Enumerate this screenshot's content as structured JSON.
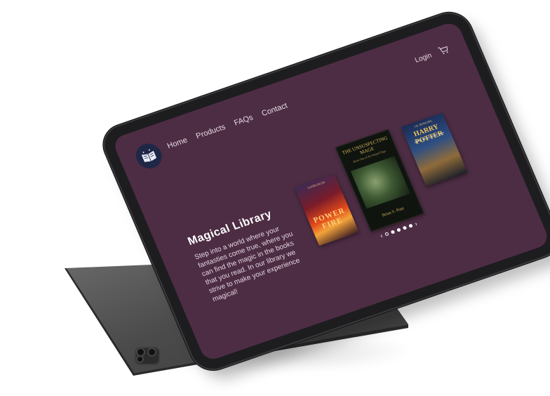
{
  "site": {
    "brand_logo": "open-book-icon",
    "nav": [
      "Home",
      "Products",
      "FAQs",
      "Contact"
    ],
    "login_label": "Login",
    "cart_icon": "cart-icon",
    "hero": {
      "title": "Magical Library",
      "text": "Step into a world where your fantasties come true, where you can find the magic in the books that you read. In our library we strive to make your experience magical!"
    },
    "books": [
      {
        "top": "LAURA ELLIS",
        "title": "POWER FIRE",
        "bottom": ""
      },
      {
        "top": "THE UNSUSPECTING MAGE",
        "subtitle": "Book One of the Warped Saga",
        "bottom": "Brian S. Pratt"
      },
      {
        "top": "J.K. ROWLING",
        "title": "HARRY POTTER",
        "subtitle": "and the Philosopher's Stone"
      }
    ],
    "carousel": {
      "prev": "‹",
      "next": "›",
      "dots": 5,
      "active_index": 0
    }
  },
  "colors": {
    "screen_bg": "#4d2d44",
    "logo_bg": "#1f2746",
    "device": "#1d1d1f"
  }
}
